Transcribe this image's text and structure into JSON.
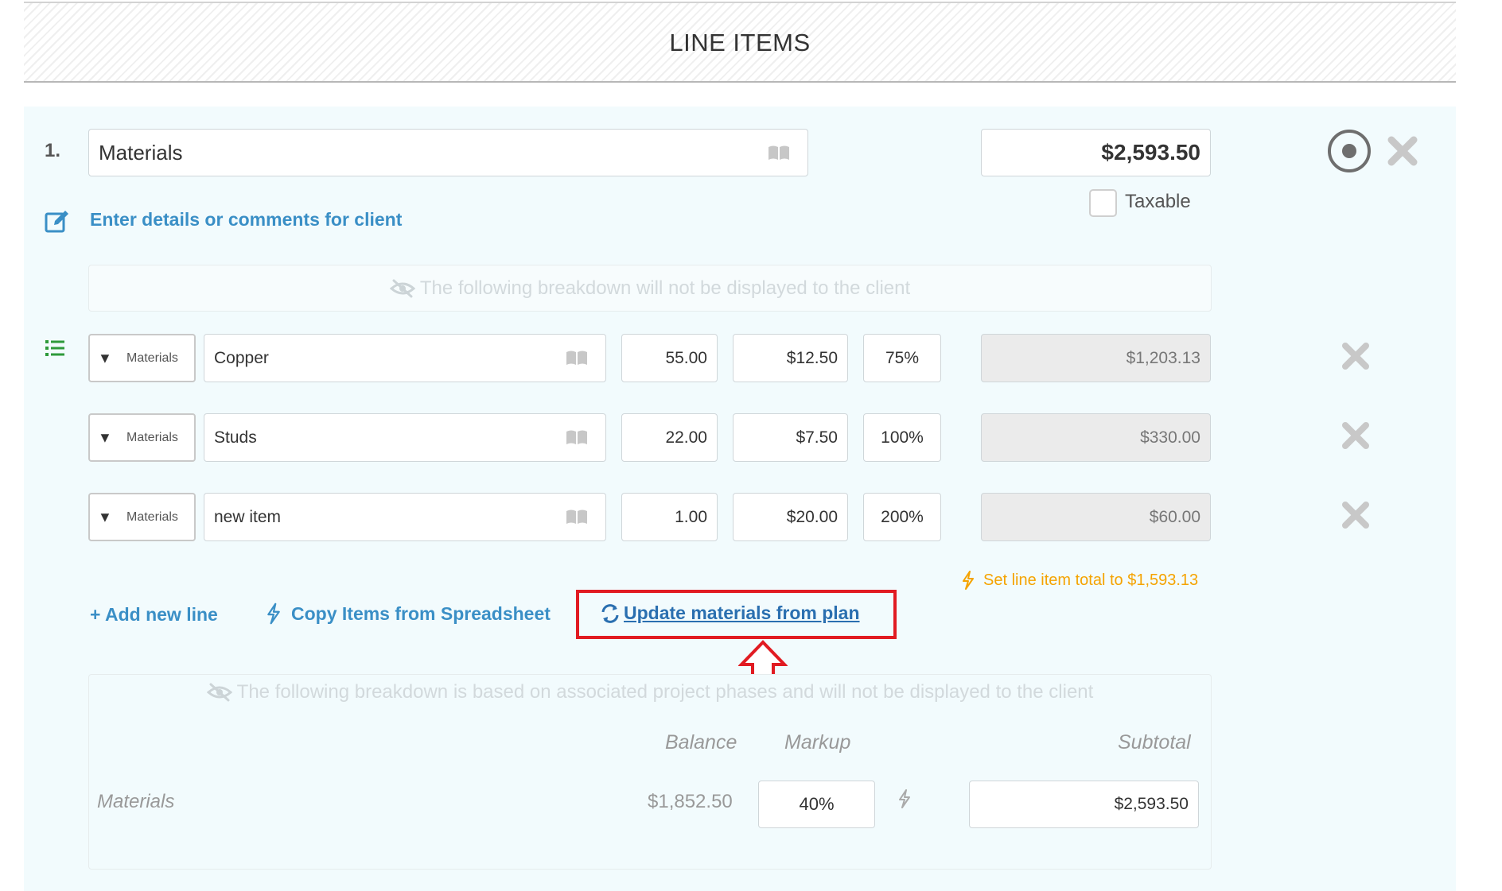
{
  "header": {
    "title": "LINE ITEMS"
  },
  "line_item": {
    "number": "1.",
    "name": "Materials",
    "total": "$2,593.50",
    "taxable_label": "Taxable",
    "details_link": "Enter details or comments for client"
  },
  "breakdown_notice": "The following breakdown will not be displayed to the client",
  "rows": [
    {
      "category": "Materials",
      "name": "Copper",
      "qty": "55.00",
      "price": "$12.50",
      "markup": "75%",
      "total": "$1,203.13"
    },
    {
      "category": "Materials",
      "name": "Studs",
      "qty": "22.00",
      "price": "$7.50",
      "markup": "100%",
      "total": "$330.00"
    },
    {
      "category": "Materials",
      "name": "new item",
      "qty": "1.00",
      "price": "$20.00",
      "markup": "200%",
      "total": "$60.00"
    }
  ],
  "set_total_link": "Set line item total to $1,593.13",
  "actions": {
    "add_line": "+ Add new line",
    "copy_items": "Copy Items from Spreadsheet",
    "update_materials": "Update materials from plan"
  },
  "phase_breakdown": {
    "notice": "The following breakdown is based on associated project phases and will not be displayed to the client",
    "headers": {
      "balance": "Balance",
      "markup": "Markup",
      "subtotal": "Subtotal"
    },
    "row": {
      "label": "Materials",
      "balance": "$1,852.50",
      "markup": "40%",
      "subtotal": "$2,593.50"
    }
  },
  "colors": {
    "link": "#3a8fc6",
    "warning": "#f5a300",
    "highlight_box": "#e11b22",
    "panel_bg": "#f2fbfd",
    "list_icon": "#2e9a3a"
  }
}
